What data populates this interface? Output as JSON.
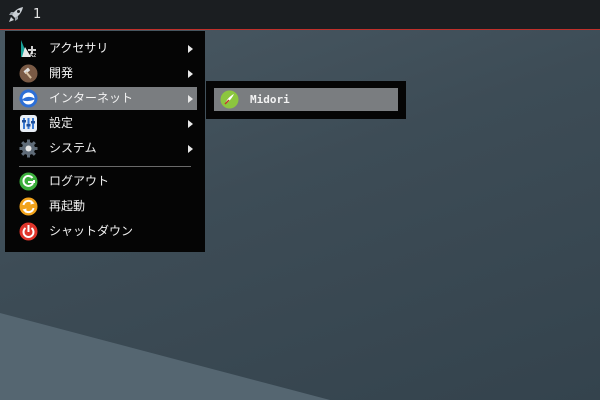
{
  "panel": {
    "launcher_icon": "rocket-icon",
    "workspace_number": "1"
  },
  "main_menu": {
    "items": [
      {
        "label": "アクセサリ",
        "icon": "accessories-icon",
        "has_submenu": true
      },
      {
        "label": "開発",
        "icon": "hammer-icon",
        "has_submenu": true
      },
      {
        "label": "インターネット",
        "icon": "internet-globe-icon",
        "has_submenu": true,
        "selected": true
      },
      {
        "label": "設定",
        "icon": "settings-icon",
        "has_submenu": true
      },
      {
        "label": "システム",
        "icon": "gear-icon",
        "has_submenu": true
      },
      {
        "label": "ログアウト",
        "icon": "logout-icon",
        "has_submenu": false
      },
      {
        "label": "再起動",
        "icon": "restart-icon",
        "has_submenu": false
      },
      {
        "label": "シャットダウン",
        "icon": "power-icon",
        "has_submenu": false
      }
    ]
  },
  "internet_submenu": {
    "items": [
      {
        "label": "Midori",
        "icon": "midori-browser-icon",
        "selected": true
      }
    ]
  },
  "colors": {
    "panel_bg": "#1b1e21",
    "panel_border": "#c0302b",
    "menu_bg": "#050505",
    "selection": "#7a7d80",
    "desktop": "#3f4f59"
  }
}
